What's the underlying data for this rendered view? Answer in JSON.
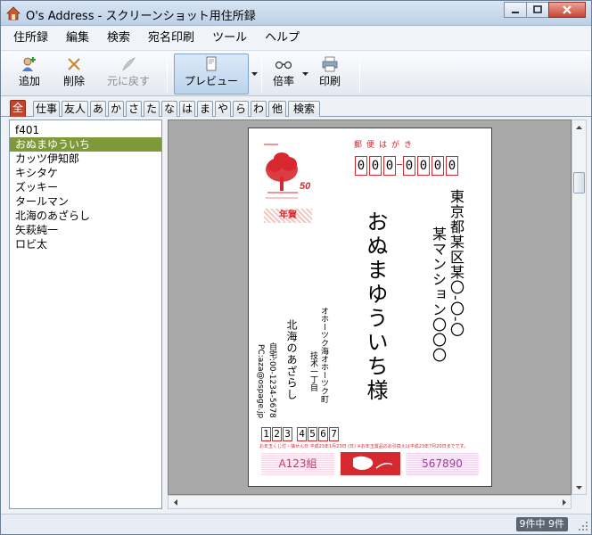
{
  "window": {
    "title": "O's Address - スクリーンショット用住所録"
  },
  "menu": [
    "住所録",
    "編集",
    "検索",
    "宛名印刷",
    "ツール",
    "ヘルプ"
  ],
  "toolbar": {
    "add": "追加",
    "delete": "削除",
    "undo": "元に戻す",
    "preview": "プレビュー",
    "zoom": "倍率",
    "print": "印刷"
  },
  "tabs": [
    "全",
    "仕事",
    "友人",
    "あ",
    "か",
    "さ",
    "た",
    "な",
    "は",
    "ま",
    "や",
    "ら",
    "わ",
    "他",
    "検索"
  ],
  "contacts": [
    "f401",
    "おぬまゆういち",
    "カッツ伊知郎",
    "キシタケ",
    "ズッキー",
    "タールマン",
    "北海のあざらし",
    "矢萩純一",
    "ロビ太"
  ],
  "postcard": {
    "label": "郵便はがき",
    "zip": [
      "0",
      "0",
      "0",
      "0",
      "0",
      "0",
      "0"
    ],
    "recipient_address1": "東京都某区某〇-〇-〇",
    "recipient_address2": "某マンション〇〇〇",
    "recipient_name": "おぬまゆういち様",
    "stamp_value": "50",
    "nenga": "年賀",
    "sender_address1": "オホーツク海オホーツク町",
    "sender_address2": "技术一丁目",
    "sender_name": "北海のあざらし",
    "sender_phone": "自宅:00-1234-5678",
    "sender_email": "PC:aza@ospage.jp",
    "sender_zip": [
      "1",
      "2",
      "3",
      "4",
      "5",
      "6",
      "7"
    ],
    "lottery_note": "お年玉くじ付・抽せん日 平成23年1月23日 (日)  ※お年玉賞品のお引換えは平成23年7月20日までです。",
    "lottery_group": "A123組",
    "lottery_number": "567890"
  },
  "status": {
    "count": "9件中 9件"
  },
  "colors": {
    "accent_red": "#d8282f",
    "selection_green": "#7d9939",
    "active_tab": "#c2462f"
  }
}
